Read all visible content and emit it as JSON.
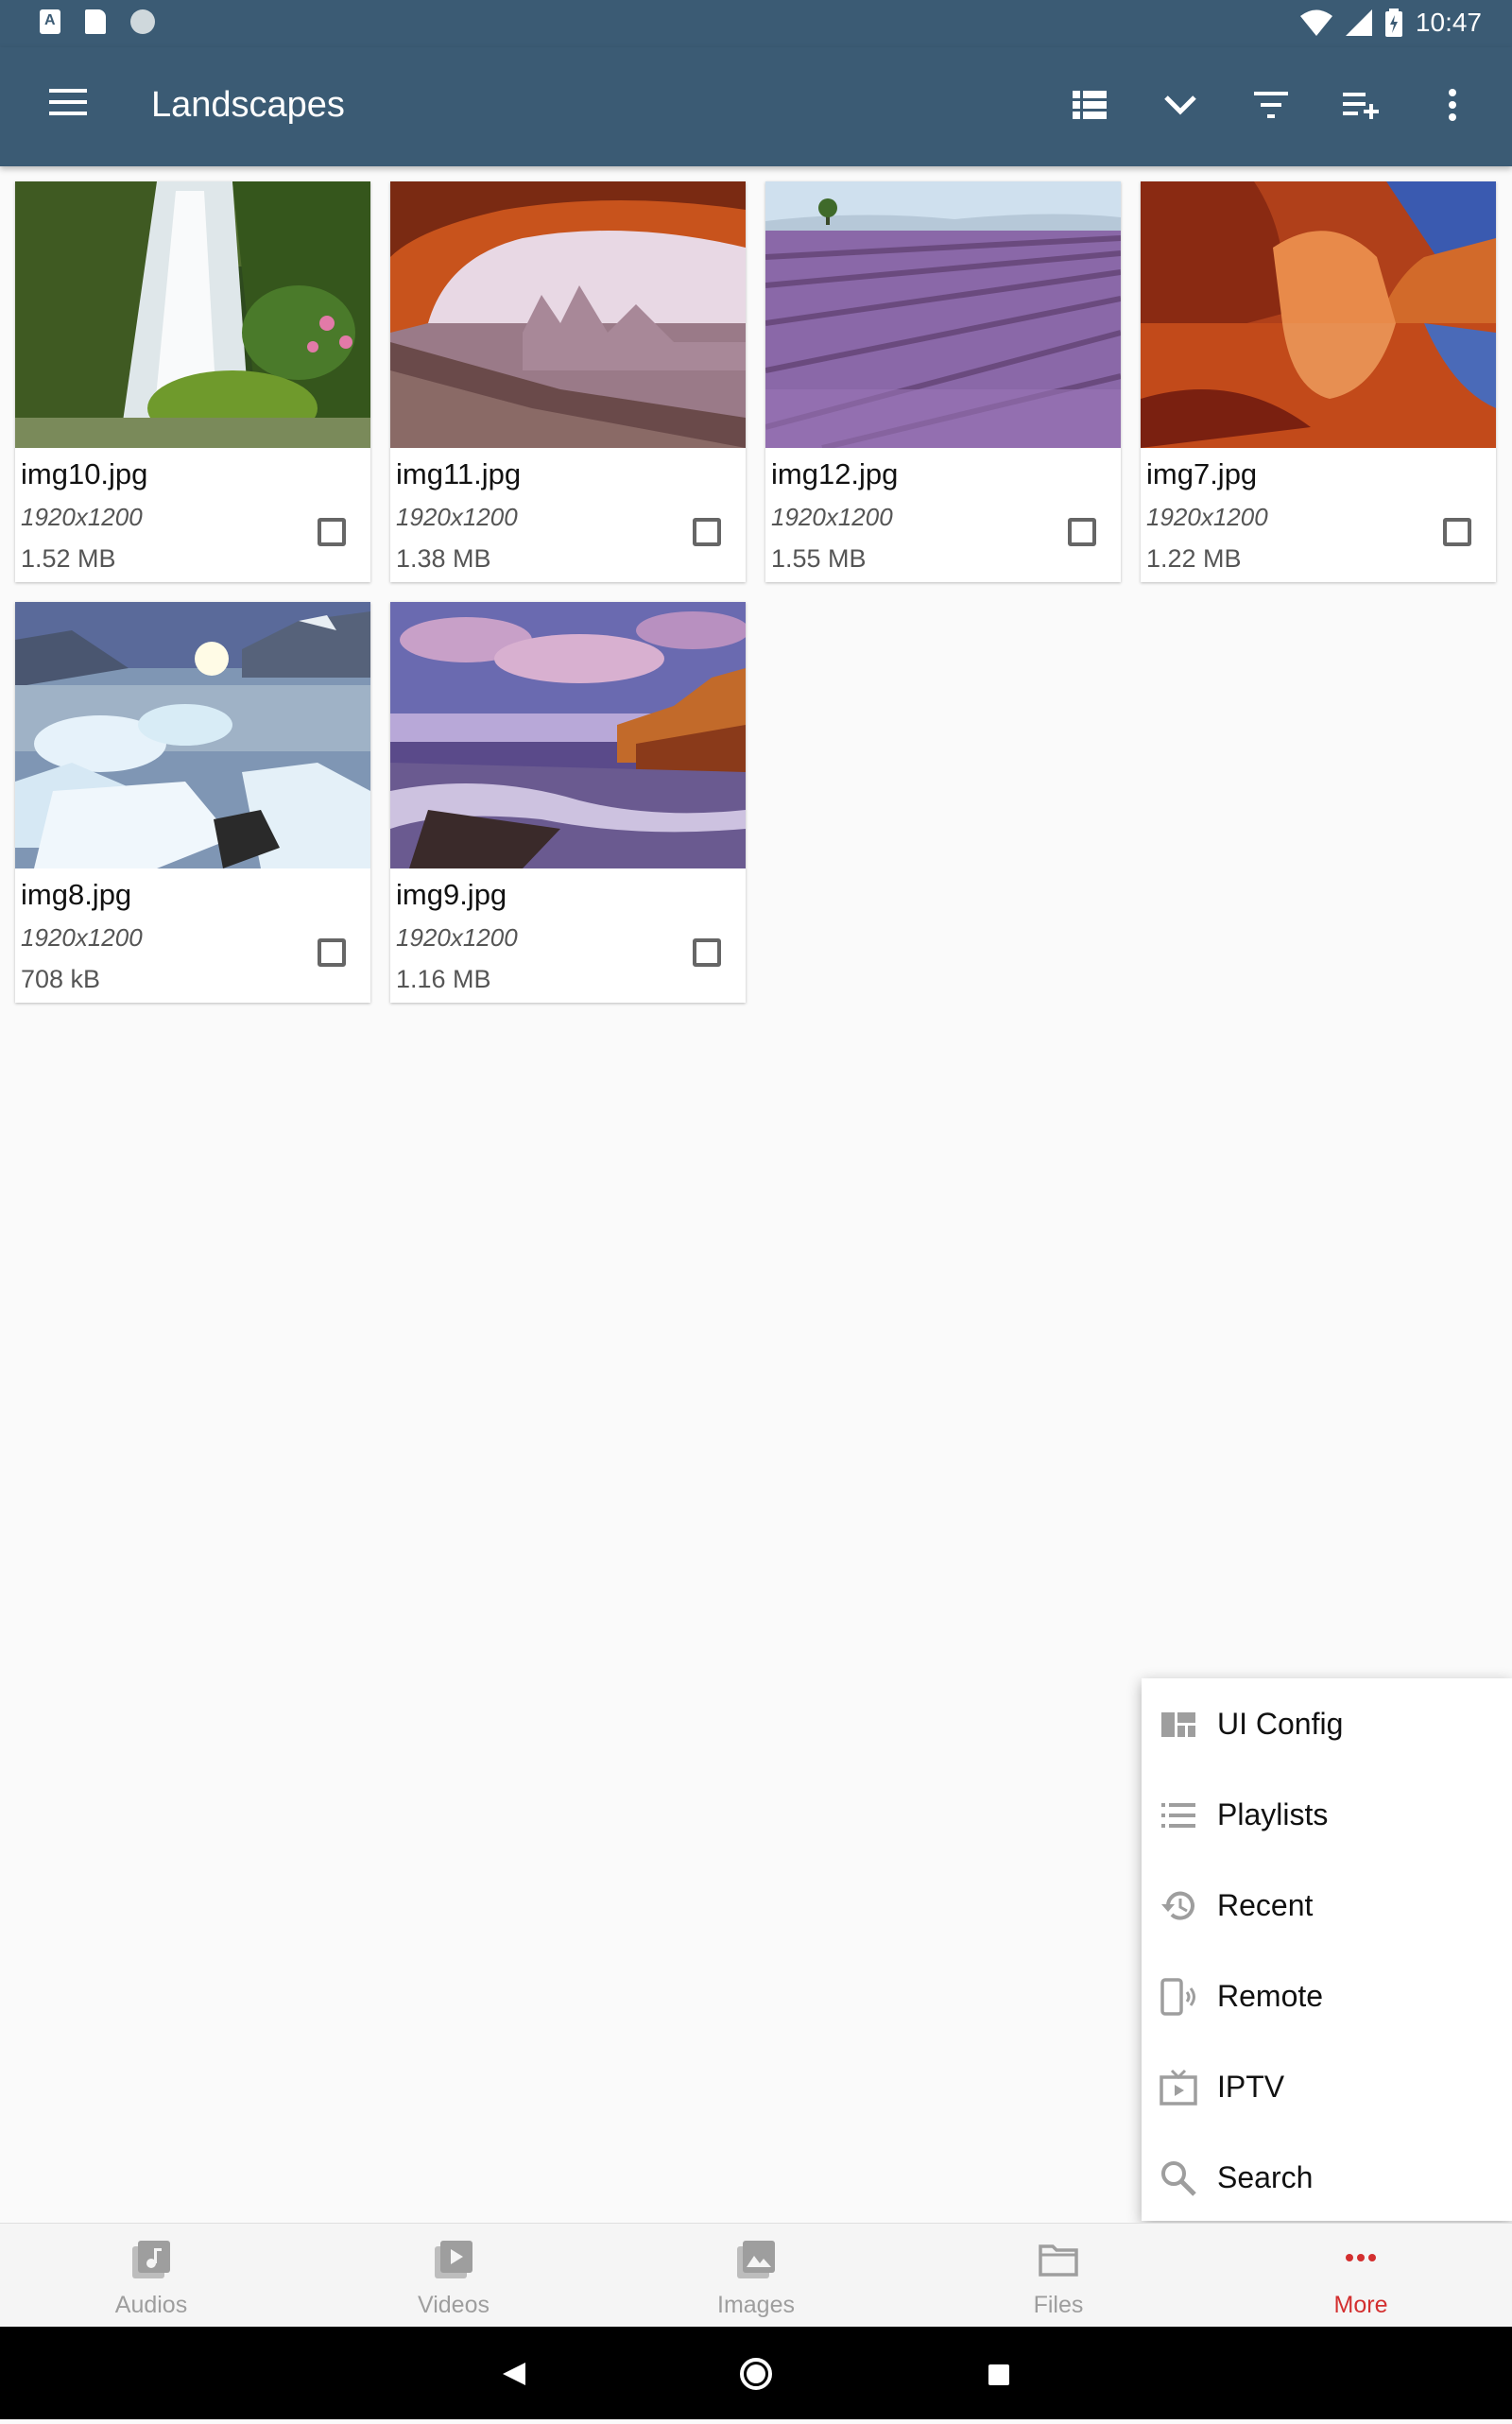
{
  "status_bar": {
    "time": "10:47"
  },
  "app_bar": {
    "title": "Landscapes",
    "actions": [
      "list-view-icon",
      "chevron-down-icon",
      "filter-icon",
      "playlist-add-icon",
      "more-vert-icon"
    ]
  },
  "images": [
    {
      "filename": "img10.jpg",
      "resolution": "1920x1200",
      "size": "1.52 MB",
      "thumbnail": "waterfall"
    },
    {
      "filename": "img11.jpg",
      "resolution": "1920x1200",
      "size": "1.38 MB",
      "thumbnail": "arch"
    },
    {
      "filename": "img12.jpg",
      "resolution": "1920x1200",
      "size": "1.55 MB",
      "thumbnail": "lavender"
    },
    {
      "filename": "img7.jpg",
      "resolution": "1920x1200",
      "size": "1.22 MB",
      "thumbnail": "canyon"
    },
    {
      "filename": "img8.jpg",
      "resolution": "1920x1200",
      "size": "708 kB",
      "thumbnail": "glacier"
    },
    {
      "filename": "img9.jpg",
      "resolution": "1920x1200",
      "size": "1.16 MB",
      "thumbnail": "seashore"
    }
  ],
  "popup_menu": {
    "items": [
      {
        "label": "UI Config",
        "icon": "dashboard-icon"
      },
      {
        "label": "Playlists",
        "icon": "list-icon"
      },
      {
        "label": "Recent",
        "icon": "history-icon"
      },
      {
        "label": "Remote",
        "icon": "remote-device-icon"
      },
      {
        "label": "IPTV",
        "icon": "tv-icon"
      },
      {
        "label": "Search",
        "icon": "search-icon"
      }
    ]
  },
  "bottom_nav": {
    "items": [
      {
        "label": "Audios",
        "icon": "audio-icon"
      },
      {
        "label": "Videos",
        "icon": "video-icon"
      },
      {
        "label": "Images",
        "icon": "image-icon"
      },
      {
        "label": "Files",
        "icon": "folder-icon"
      },
      {
        "label": "More",
        "icon": "more-dots-icon",
        "active": true
      }
    ]
  },
  "colors": {
    "app_bar": "#3b5b74",
    "accent": "#d32f2f"
  }
}
